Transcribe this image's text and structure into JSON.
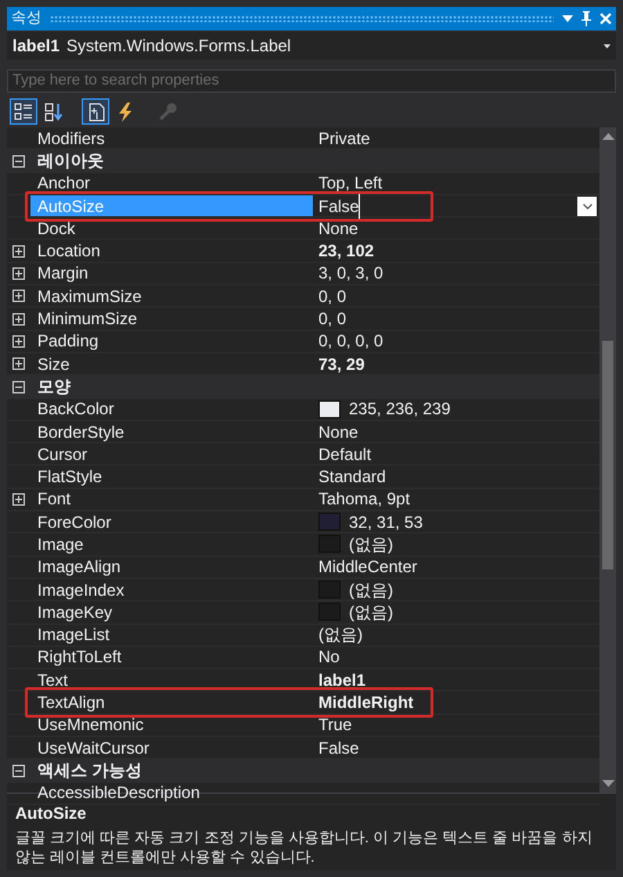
{
  "window": {
    "title": "속성"
  },
  "object": {
    "name": "label1",
    "type": "System.Windows.Forms.Label"
  },
  "search": {
    "placeholder": "Type here to search properties"
  },
  "toolbar": [
    {
      "kind": "categorized",
      "selected": true,
      "disabled": false
    },
    {
      "kind": "alphabetical",
      "selected": false,
      "disabled": false
    },
    {
      "kind": "properties",
      "selected": true,
      "disabled": false
    },
    {
      "kind": "events",
      "selected": false,
      "disabled": false
    },
    {
      "kind": "pages",
      "selected": false,
      "disabled": true
    }
  ],
  "rows": [
    {
      "kind": "property",
      "name": "Modifiers",
      "value": "Private",
      "bold": false,
      "selected": false
    },
    {
      "kind": "category",
      "name": "레이아웃",
      "expanded": true
    },
    {
      "kind": "property",
      "name": "Anchor",
      "value": "Top, Left",
      "bold": false,
      "selected": false
    },
    {
      "kind": "property",
      "name": "AutoSize",
      "value": "False",
      "bold": false,
      "selected": true,
      "outlined": true
    },
    {
      "kind": "property",
      "name": "Dock",
      "value": "None",
      "bold": false,
      "selected": false
    },
    {
      "kind": "property",
      "name": "Location",
      "value": "23, 102",
      "bold": true,
      "selected": false,
      "expandable": true
    },
    {
      "kind": "property",
      "name": "Margin",
      "value": "3, 0, 3, 0",
      "bold": false,
      "selected": false,
      "expandable": true
    },
    {
      "kind": "property",
      "name": "MaximumSize",
      "value": "0, 0",
      "bold": false,
      "selected": false,
      "expandable": true
    },
    {
      "kind": "property",
      "name": "MinimumSize",
      "value": "0, 0",
      "bold": false,
      "selected": false,
      "expandable": true
    },
    {
      "kind": "property",
      "name": "Padding",
      "value": "0, 0, 0, 0",
      "bold": false,
      "selected": false,
      "expandable": true
    },
    {
      "kind": "property",
      "name": "Size",
      "value": "73, 29",
      "bold": true,
      "selected": false,
      "expandable": true
    },
    {
      "kind": "category",
      "name": "모양",
      "expanded": true
    },
    {
      "kind": "property",
      "name": "BackColor",
      "value": "235, 236, 239",
      "bold": false,
      "selected": false,
      "color": "#ebecef"
    },
    {
      "kind": "property",
      "name": "BorderStyle",
      "value": "None",
      "bold": false,
      "selected": false
    },
    {
      "kind": "property",
      "name": "Cursor",
      "value": "Default",
      "bold": false,
      "selected": false
    },
    {
      "kind": "property",
      "name": "FlatStyle",
      "value": "Standard",
      "bold": false,
      "selected": false
    },
    {
      "kind": "property",
      "name": "Font",
      "value": "Tahoma, 9pt",
      "bold": false,
      "selected": false,
      "expandable": true
    },
    {
      "kind": "property",
      "name": "ForeColor",
      "value": "32, 31, 53",
      "bold": false,
      "selected": false,
      "color": "#201f35"
    },
    {
      "kind": "property",
      "name": "Image",
      "value": "(없음)",
      "bold": false,
      "selected": false,
      "color": "#1b1b1c"
    },
    {
      "kind": "property",
      "name": "ImageAlign",
      "value": "MiddleCenter",
      "bold": false,
      "selected": false
    },
    {
      "kind": "property",
      "name": "ImageIndex",
      "value": "(없음)",
      "bold": false,
      "selected": false,
      "color": "#1b1b1c"
    },
    {
      "kind": "property",
      "name": "ImageKey",
      "value": "(없음)",
      "bold": false,
      "selected": false,
      "color": "#1b1b1c"
    },
    {
      "kind": "property",
      "name": "ImageList",
      "value": "(없음)",
      "bold": false,
      "selected": false
    },
    {
      "kind": "property",
      "name": "RightToLeft",
      "value": "No",
      "bold": false,
      "selected": false
    },
    {
      "kind": "property",
      "name": "Text",
      "value": "label1",
      "bold": true,
      "selected": false
    },
    {
      "kind": "property",
      "name": "TextAlign",
      "value": "MiddleRight",
      "bold": true,
      "selected": false,
      "outlined": true
    },
    {
      "kind": "property",
      "name": "UseMnemonic",
      "value": "True",
      "bold": false,
      "selected": false
    },
    {
      "kind": "property",
      "name": "UseWaitCursor",
      "value": "False",
      "bold": false,
      "selected": false
    },
    {
      "kind": "category",
      "name": "액세스 가능성",
      "expanded": true
    },
    {
      "kind": "property",
      "name": "AccessibleDescription",
      "selected": false
    }
  ],
  "description": {
    "title": "AutoSize",
    "text": "글꼴 크기에 따른 자동 크기 조정 기능을 사용합니다. 이 기능은 텍스트 줄 바꿈을 하지 않는 레이블 컨트롤에만 사용할 수 있습니다."
  }
}
